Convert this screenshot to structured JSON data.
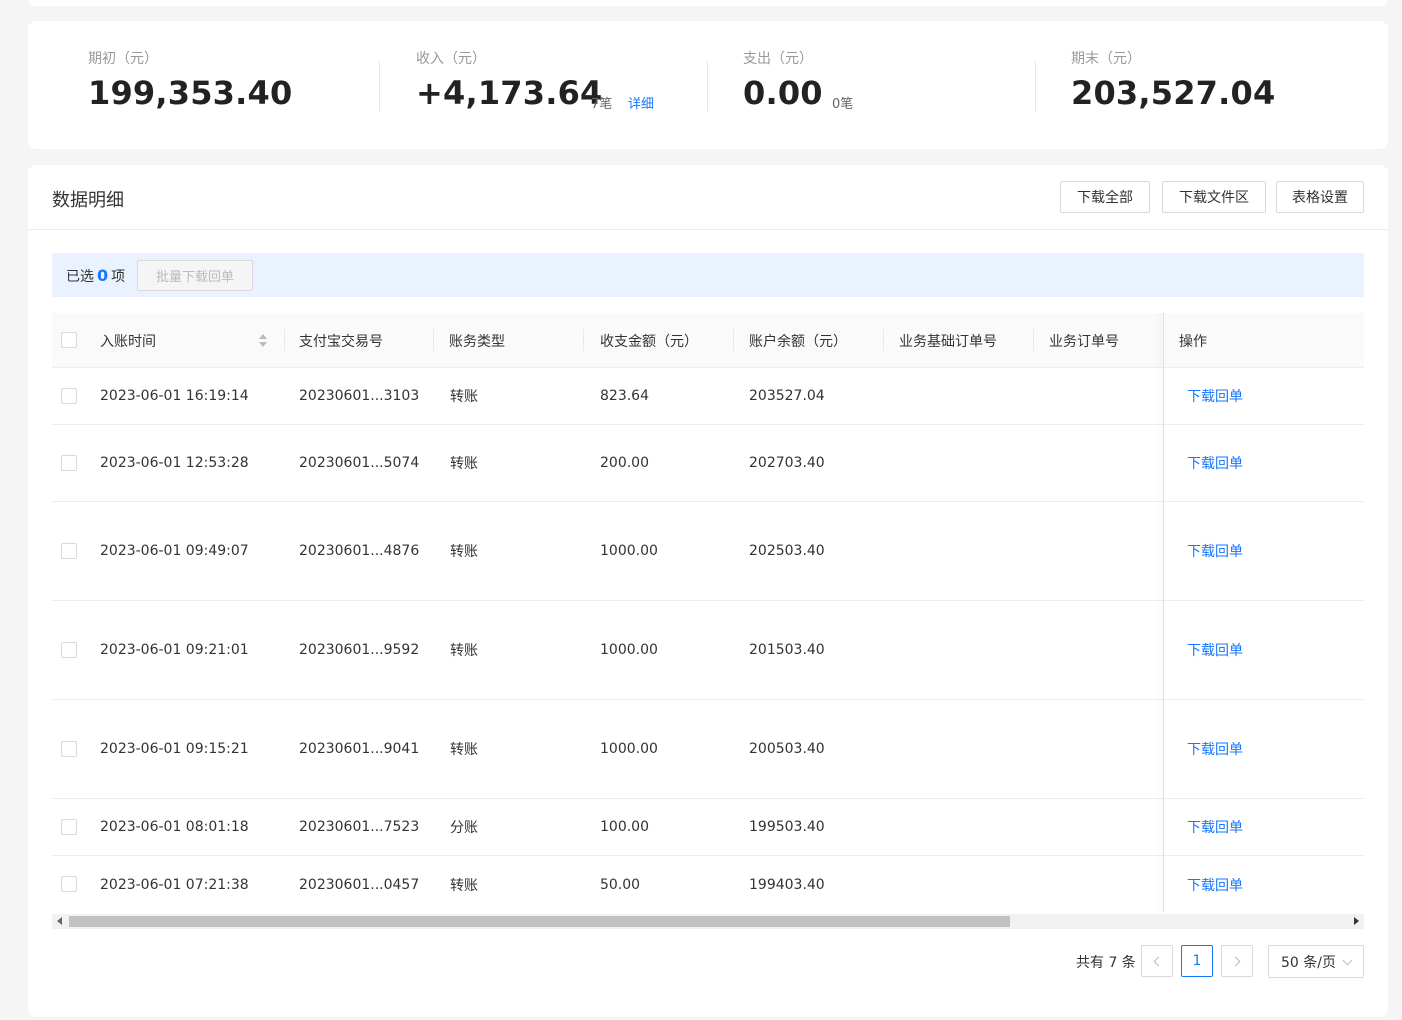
{
  "summary": {
    "opening": {
      "label": "期初（元）",
      "value": "199,353.40"
    },
    "income": {
      "label": "收入（元）",
      "value": "+4,173.64",
      "count": "7笔",
      "detail": "详细"
    },
    "expense": {
      "label": "支出（元）",
      "value": "0.00",
      "count": "0笔"
    },
    "closing": {
      "label": "期末（元）",
      "value": "203,527.04"
    }
  },
  "panel": {
    "title": "数据明细",
    "download_all": "下载全部",
    "download_files": "下载文件区",
    "table_settings": "表格设置"
  },
  "selection": {
    "prefix": "已选",
    "count": "0",
    "suffix": "项",
    "batch_download": "批量下载回单"
  },
  "table": {
    "columns": [
      "入账时间",
      "支付宝交易号",
      "账务类型",
      "收支金额（元）",
      "账户余额（元）",
      "业务基础订单号",
      "业务订单号",
      "操作"
    ],
    "rows": [
      {
        "time": "2023-06-01 16:19:14",
        "trade_no": "20230601...3103",
        "type": "转账",
        "amount": "823.64",
        "balance": "203527.04",
        "base_order": "",
        "order": "",
        "action": "下载回单"
      },
      {
        "time": "2023-06-01 12:53:28",
        "trade_no": "20230601...5074",
        "type": "转账",
        "amount": "200.00",
        "balance": "202703.40",
        "base_order": "",
        "order": "",
        "action": "下载回单"
      },
      {
        "time": "2023-06-01 09:49:07",
        "trade_no": "20230601...4876",
        "type": "转账",
        "amount": "1000.00",
        "balance": "202503.40",
        "base_order": "",
        "order": "",
        "action": "下载回单"
      },
      {
        "time": "2023-06-01 09:21:01",
        "trade_no": "20230601...9592",
        "type": "转账",
        "amount": "1000.00",
        "balance": "201503.40",
        "base_order": "",
        "order": "",
        "action": "下载回单"
      },
      {
        "time": "2023-06-01 09:15:21",
        "trade_no": "20230601...9041",
        "type": "转账",
        "amount": "1000.00",
        "balance": "200503.40",
        "base_order": "",
        "order": "",
        "action": "下载回单"
      },
      {
        "time": "2023-06-01 08:01:18",
        "trade_no": "20230601...7523",
        "type": "分账",
        "amount": "100.00",
        "balance": "199503.40",
        "base_order": "",
        "order": "",
        "action": "下载回单"
      },
      {
        "time": "2023-06-01 07:21:38",
        "trade_no": "20230601...0457",
        "type": "转账",
        "amount": "50.00",
        "balance": "199403.40",
        "base_order": "",
        "order": "",
        "action": "下载回单"
      }
    ]
  },
  "pagination": {
    "total": "共有 7 条",
    "current_page": "1",
    "page_size": "50 条/页"
  },
  "colors": {
    "accent": "#1677ff",
    "selection_bg": "#eaf2ff"
  }
}
